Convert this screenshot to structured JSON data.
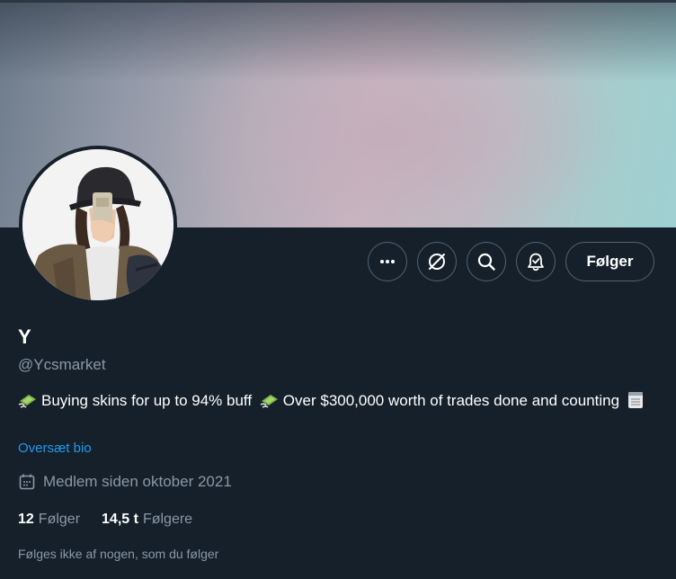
{
  "profile": {
    "name": "Y",
    "handle": "@Ycsmarket",
    "bio_part1": "Buying skins for up to 94% buff",
    "bio_part2": "Over $300,000 worth of trades done and counting",
    "translate_bio": "Oversæt bio",
    "joined": "Medlem siden oktober 2021",
    "following_count": "12",
    "following_label": "Følger",
    "followers_count": "14,5 t",
    "followers_label": "Følgere",
    "followed_by_note": "Følges ikke af nogen, som du følger"
  },
  "actions": {
    "more_icon": "more-icon",
    "grok_icon": "grok-icon",
    "search_icon": "search-icon",
    "notify_icon": "bell-notify-icon",
    "follow_label": "Følger"
  },
  "colors": {
    "background": "#15202b",
    "secondary_text": "#8b98a5",
    "link": "#1d9bf0",
    "border": "#536471"
  }
}
